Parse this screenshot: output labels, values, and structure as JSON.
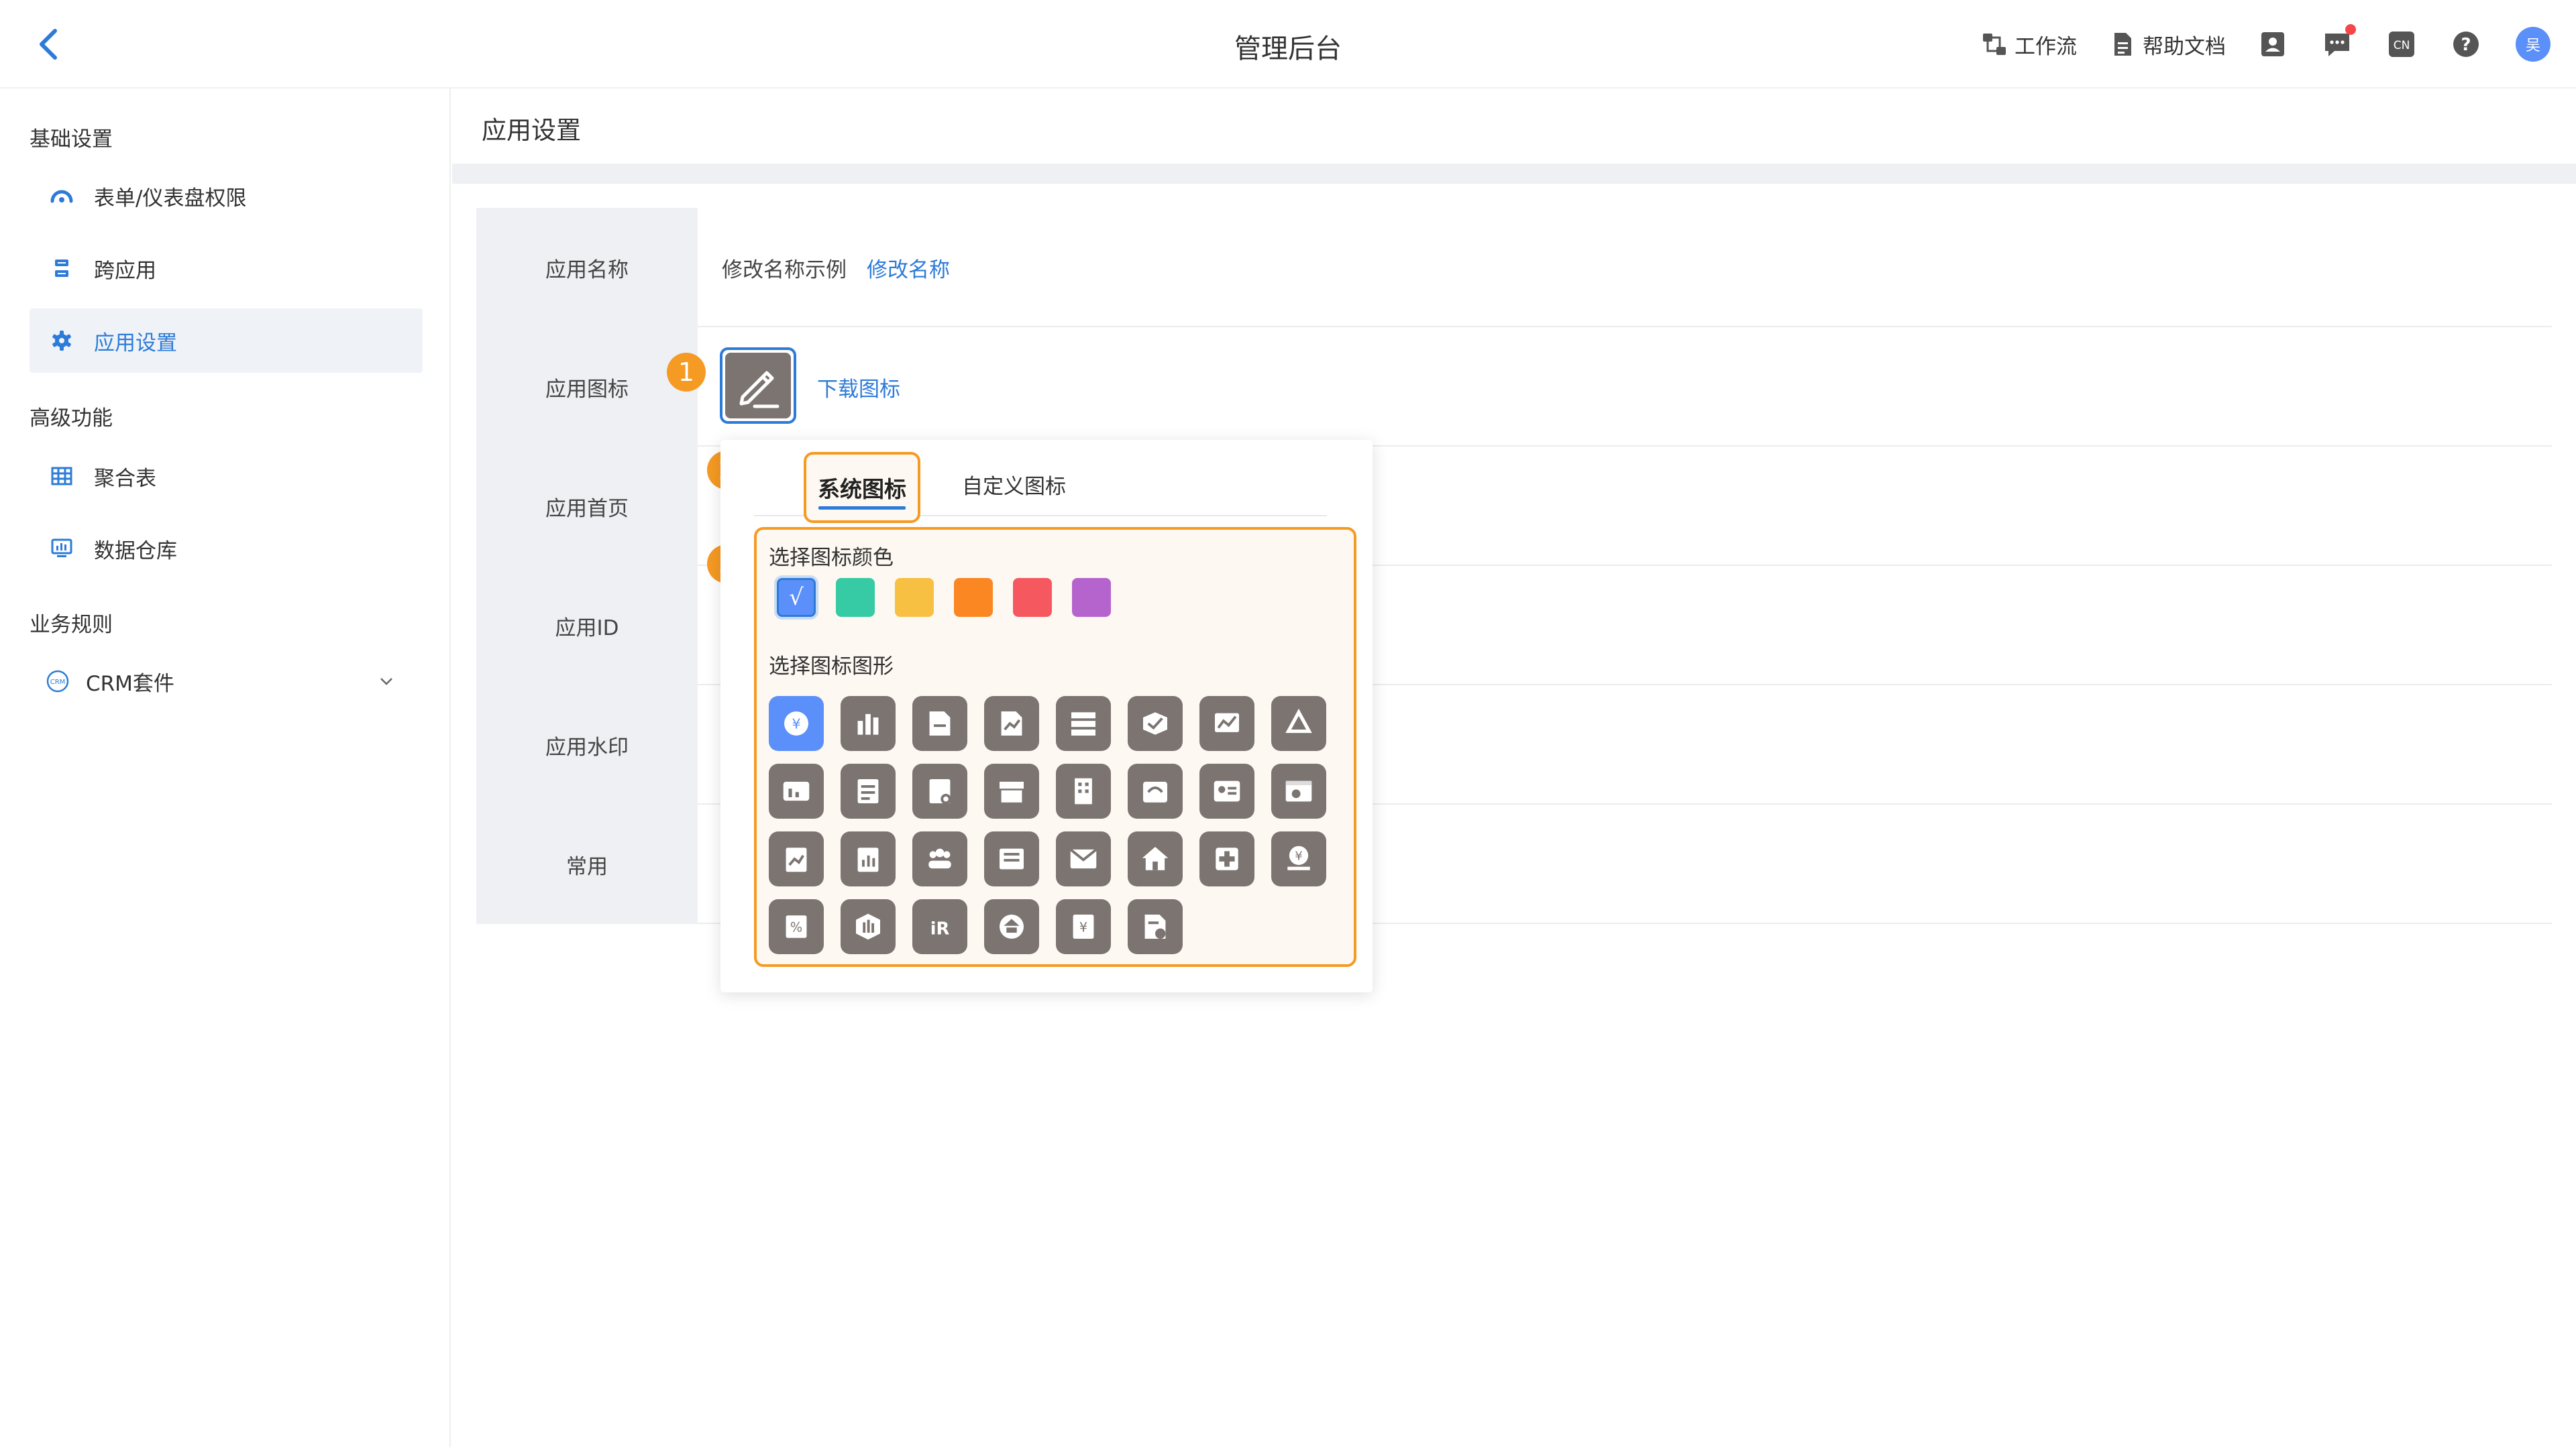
{
  "header": {
    "title": "管理后台",
    "workflow": "工作流",
    "help_docs": "帮助文档",
    "lang": "CN",
    "avatar_text": "吴"
  },
  "sidebar": {
    "group_basic": "基础设置",
    "item_form_perm": "表单/仪表盘权限",
    "item_cross_app": "跨应用",
    "item_app_settings": "应用设置",
    "group_advanced": "高级功能",
    "item_aggregate": "聚合表",
    "item_warehouse": "数据仓库",
    "group_rules": "业务规则",
    "item_crm": "CRM套件"
  },
  "main": {
    "title": "应用设置",
    "rows": [
      {
        "label": "应用名称"
      },
      {
        "label": "应用图标"
      },
      {
        "label": "应用首页"
      },
      {
        "label": "应用ID"
      },
      {
        "label": "应用水印"
      },
      {
        "label": "常用"
      }
    ],
    "app_name_value": "修改名称示例",
    "rename_link": "修改名称",
    "download_icon_link": "下载图标"
  },
  "badges": [
    "1",
    "2",
    "3"
  ],
  "popup": {
    "tab_system": "系统图标",
    "tab_custom": "自定义图标",
    "color_label": "选择图标颜色",
    "shape_label": "选择图标图形",
    "selected_mark": "√",
    "colors": [
      "#5b8ff9",
      "#36cba4",
      "#f8c042",
      "#fb8722",
      "#f5585f",
      "#b564cd"
    ],
    "selected_color_index": 0,
    "shape_icon_color": "#7c7471",
    "shapes": [
      "yen-pie-icon",
      "building-chart-icon",
      "document-chart-icon",
      "file-trend-icon",
      "server-list-icon",
      "handshake-icon",
      "line-chart-icon",
      "recycle-icon",
      "wallet-chart-icon",
      "document-list-icon",
      "file-settings-icon",
      "shop-icon",
      "office-building-icon",
      "cloud-box-icon",
      "id-card-icon",
      "web-browser-icon",
      "clipboard-chart-icon",
      "clipboard-bar-icon",
      "team-icon",
      "newspaper-icon",
      "mail-attachment-icon",
      "house-icon",
      "medical-cross-icon",
      "yen-hand-icon",
      "percent-tag-icon",
      "shield-bars-icon",
      "hr-icon",
      "enterprise-icon",
      "yen-book-icon",
      "document-info-icon"
    ]
  }
}
